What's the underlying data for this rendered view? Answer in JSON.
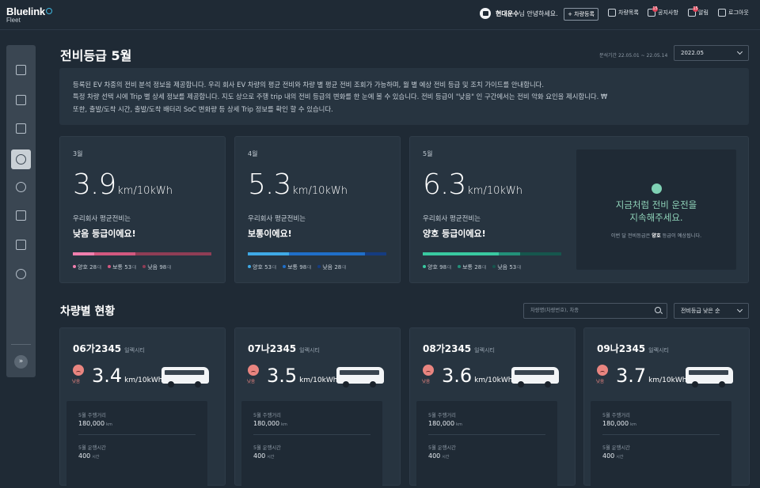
{
  "header": {
    "logo": "Bluelink",
    "logo_sub": "Fleet",
    "company": "현대운수",
    "greeting": "님 안녕하세요.",
    "register": "+ 차량등록",
    "nav": [
      {
        "label": "차량목록",
        "badge": ""
      },
      {
        "label": "공지사항",
        "badge": "15"
      },
      {
        "label": "알림",
        "badge": "15"
      },
      {
        "label": "로그아웃",
        "badge": ""
      }
    ]
  },
  "page": {
    "title": "전비등급 5월",
    "period": "분석기간 22.05.01 ~ 22.05.14",
    "month_select": "2022.05"
  },
  "info": {
    "lines": [
      "등록된 EV 차종의 전비 분석 정보을 제공합니다. 우리 회사 EV 차량의 평균 전비와 차량 별 평균 전비 조회가 가능하며, 월 별 예상 전비 등급 및 조치 가이드를 안내합니다.",
      "특정 차량 선택 시에 Trip 별 상세 정보를 제공합니다. 지도 상으로 주행 trip 내의 전비 등급의 변화를 한 눈에 볼 수 있습니다. 전비 등급이 \"낮음\" 인 구간에서는 전비 악화 요인을 제시합니다. ₩",
      "또한, 출발/도착 시간, 출발/도착 배터리 SoC 변화량 등 상세 Trip 정보를 확인 할 수 있습니다."
    ]
  },
  "grades": [
    {
      "month": "3월",
      "value": "3.9",
      "unit": "km/10kWh",
      "sub": "우리회사 평균전비는",
      "grade": "낮음 등급이에요!",
      "legend": [
        {
          "label": "양호",
          "count": "28",
          "unit": "대",
          "color": "#f07fae"
        },
        {
          "label": "보통",
          "count": "53",
          "unit": "대",
          "color": "#d2587f"
        },
        {
          "label": "낮음",
          "count": "98",
          "unit": "대",
          "color": "#8f3d55"
        }
      ],
      "shares": [
        0.156,
        0.296,
        0.548
      ]
    },
    {
      "month": "4월",
      "value": "5.3",
      "unit": "km/10kWh",
      "sub": "우리회사 평균전비는",
      "grade": "보통이에요!",
      "legend": [
        {
          "label": "양호",
          "count": "53",
          "unit": "대",
          "color": "#3fa9e6"
        },
        {
          "label": "보통",
          "count": "98",
          "unit": "대",
          "color": "#1f6fc9"
        },
        {
          "label": "낮음",
          "count": "28",
          "unit": "대",
          "color": "#153c80"
        }
      ],
      "shares": [
        0.296,
        0.548,
        0.156
      ]
    },
    {
      "month": "5월",
      "value": "6.3",
      "unit": "km/10kWh",
      "sub": "우리회사 평균전비는",
      "grade": "양호 등급이에요!",
      "legend": [
        {
          "label": "양호",
          "count": "98",
          "unit": "대",
          "color": "#39c9a0"
        },
        {
          "label": "보통",
          "count": "28",
          "unit": "대",
          "color": "#229079"
        },
        {
          "label": "낮음",
          "count": "53",
          "unit": "대",
          "color": "#16564d"
        }
      ],
      "shares": [
        0.548,
        0.156,
        0.296
      ]
    }
  ],
  "tip": {
    "line1": "지금처럼 전비 운전을",
    "line2": "지속해주세요.",
    "note_pre": "이번 달 전비등급은 ",
    "note_bold": "양호",
    "note_post": " 등급이 예상됩니다."
  },
  "vehicles_section": {
    "title": "차량별 현황",
    "search_placeholder": "차량명(차량번호), 차종",
    "sort": "전비등급 낮은 순"
  },
  "vehicles": [
    {
      "plate": "06가2345",
      "model": "일렉시티",
      "level": "낮음",
      "eff": "3.4",
      "unit": "km/10kWh",
      "k1": "5월 주행거리",
      "v1": "180,000",
      "u1": "km",
      "k2": "5월 운행시간",
      "v2": "400",
      "u2": "시간"
    },
    {
      "plate": "07나2345",
      "model": "일렉시티",
      "level": "낮음",
      "eff": "3.5",
      "unit": "km/10kWh",
      "k1": "5월 주행거리",
      "v1": "180,000",
      "u1": "km",
      "k2": "5월 운행시간",
      "v2": "400",
      "u2": "시간"
    },
    {
      "plate": "08가2345",
      "model": "일렉시티",
      "level": "낮음",
      "eff": "3.6",
      "unit": "km/10kWh",
      "k1": "5월 주행거리",
      "v1": "180,000",
      "u1": "km",
      "k2": "5월 운행시간",
      "v2": "400",
      "u2": "시간"
    },
    {
      "plate": "09나2345",
      "model": "일렉시티",
      "level": "낮음",
      "eff": "3.7",
      "unit": "km/10kWh",
      "k1": "5월 주행거리",
      "v1": "180,000",
      "u1": "km",
      "k2": "5월 운행시간",
      "v2": "400",
      "u2": "시간"
    }
  ],
  "sidebar": {
    "icons": [
      "dashboard-icon",
      "bus-icon",
      "building-icon",
      "gauge-icon",
      "charging-icon",
      "report-icon",
      "download-icon",
      "settings-icon"
    ],
    "active": "gauge-icon"
  }
}
